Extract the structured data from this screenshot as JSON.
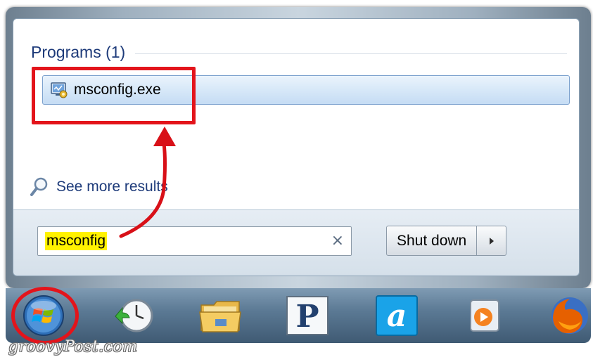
{
  "start_menu": {
    "section_title": "Programs (1)",
    "result": {
      "label": "msconfig.exe",
      "icon": "msconfig-app-icon"
    },
    "see_more_label": "See more results",
    "search": {
      "value": "msconfig",
      "clear_glyph": "×"
    },
    "shutdown_label": "Shut down"
  },
  "taskbar": {
    "icons": [
      "windows-start-orb-icon",
      "clock-restore-icon",
      "file-explorer-folder-icon",
      "p-app-icon",
      "a-app-icon",
      "media-player-icon",
      "firefox-icon"
    ]
  },
  "annotations": {
    "color": "#e3141b"
  },
  "watermark": "groovyPost.com",
  "colors": {
    "link_blue": "#1e3b7a",
    "search_highlight": "#fff200",
    "selection_border": "#7da2ce"
  }
}
